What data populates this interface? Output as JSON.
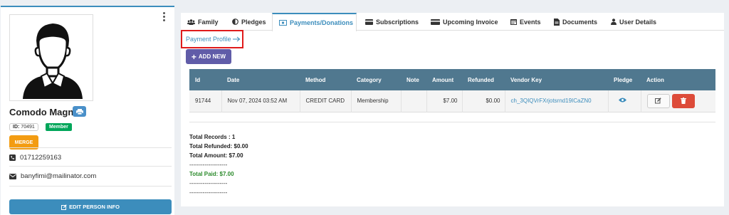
{
  "profile": {
    "name": "Comodo Magna",
    "id_label": "ID:",
    "id_value": "70491",
    "member_badge": "Member",
    "merge_label": "MERGE",
    "phone": "01712259163",
    "email": "banyfimi@mailinator.com",
    "edit_label": "EDIT PERSON INFO"
  },
  "tabs": [
    {
      "label": "Family",
      "icon": "users-icon"
    },
    {
      "label": "Pledges",
      "icon": "half-circle-icon"
    },
    {
      "label": "Payments/Donations",
      "icon": "money-icon",
      "active": true
    },
    {
      "label": "Subscriptions",
      "icon": "credit-card-icon"
    },
    {
      "label": "Upcoming Invoice",
      "icon": "credit-card-icon"
    },
    {
      "label": "Events",
      "icon": "calendar-icon"
    },
    {
      "label": "Documents",
      "icon": "file-icon"
    },
    {
      "label": "User Details",
      "icon": "user-icon"
    }
  ],
  "payment_profile_link": "Payment Profile",
  "add_new_label": "ADD NEW",
  "table": {
    "headers": [
      "Id",
      "Date",
      "Method",
      "Category",
      "Note",
      "Amount",
      "Refunded",
      "Vendor Key",
      "Pledge",
      "Action"
    ],
    "rows": [
      {
        "id": "91744",
        "date": "Nov 07, 2024 03:52 AM",
        "method": "CREDIT CARD",
        "category": "Membership",
        "note": "",
        "amount": "$7.00",
        "refunded": "$0.00",
        "vendor_key": "ch_3QIQVrFXrjotsrnd19ICaZN0"
      }
    ]
  },
  "summary": {
    "total_records": "Total Records : 1",
    "total_refunded": "Total Refunded: $0.00",
    "total_amount": "Total Amount: $7.00",
    "dashes": "--------------------",
    "total_paid": "Total Paid: $7.00"
  },
  "colors": {
    "primary": "#3c8dbc",
    "table_header": "#50788f",
    "merge": "#f39c12",
    "member": "#00a65a",
    "add_new": "#605ca8",
    "delete": "#dd4b39",
    "paid": "#2a8a2a"
  }
}
